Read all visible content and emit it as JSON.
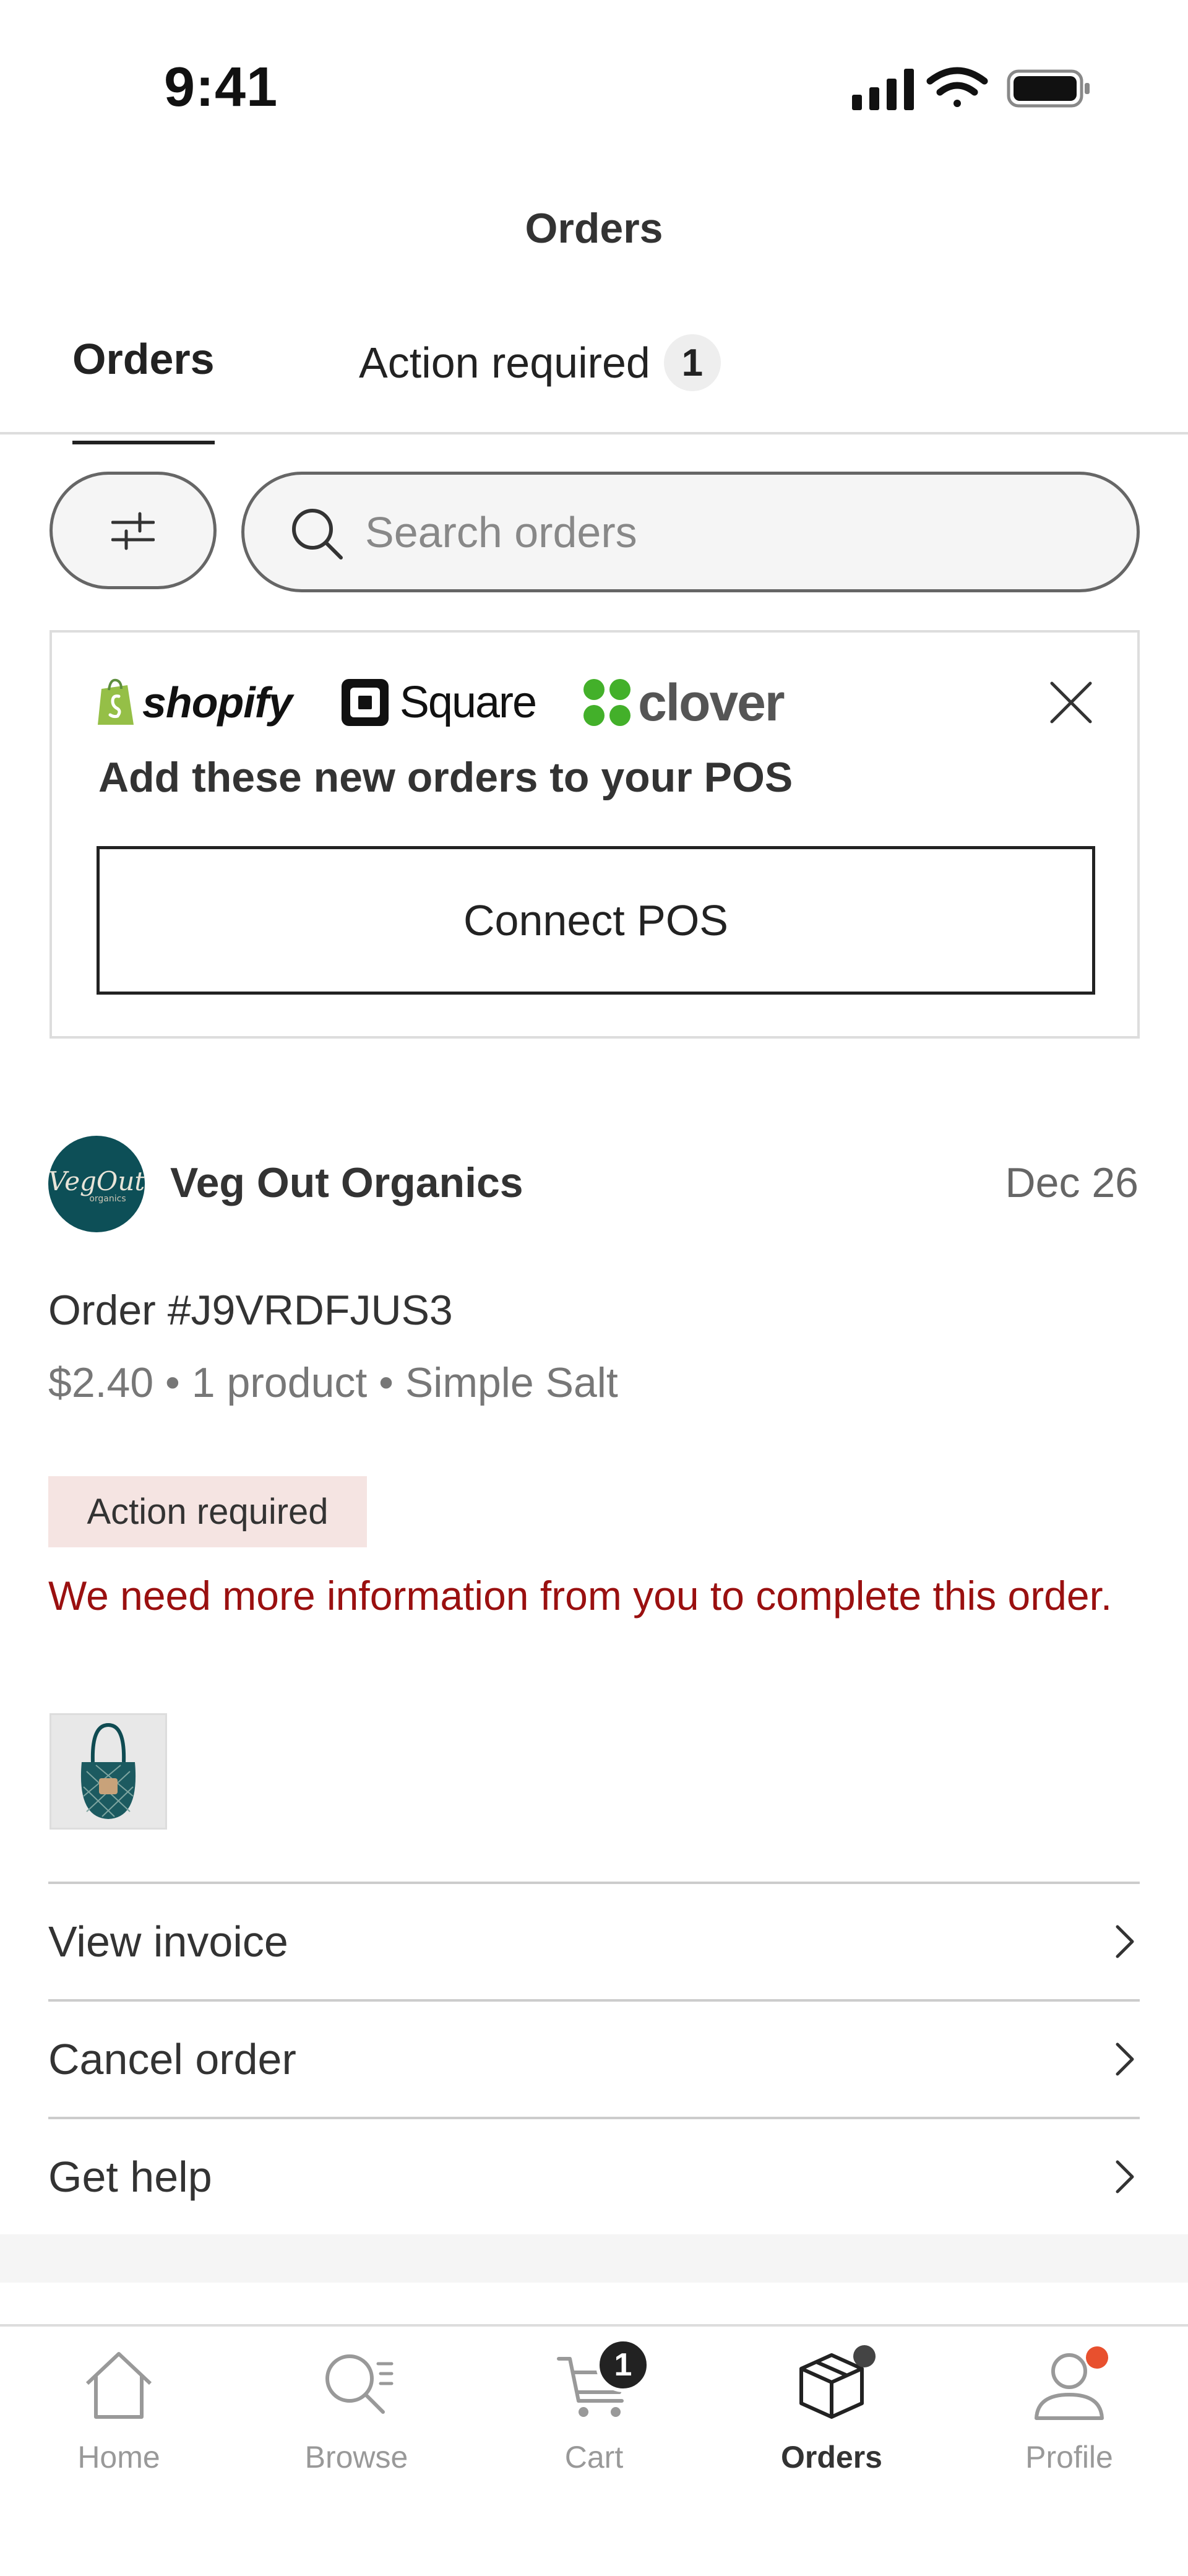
{
  "status_bar": {
    "time": "9:41"
  },
  "header": {
    "title": "Orders"
  },
  "tabs": [
    {
      "label": "Orders",
      "active": true
    },
    {
      "label": "Action required",
      "badge": "1",
      "active": false
    }
  ],
  "search": {
    "placeholder": "Search orders"
  },
  "pos_banner": {
    "logos": {
      "shopify": "shopify",
      "square": "Square",
      "clover": "clover"
    },
    "heading": "Add these new orders to your POS",
    "button_label": "Connect POS"
  },
  "order": {
    "shop_name": "Veg Out Organics",
    "avatar_text": "VegOut",
    "avatar_subtext": "organics",
    "date": "Dec 26",
    "number": "Order #J9VRDFJUS3",
    "summary": "$2.40 • 1 product • Simple Salt",
    "status_badge": "Action required",
    "message": "We need more information from you to complete this order."
  },
  "links": [
    {
      "label": "View invoice"
    },
    {
      "label": "Cancel order"
    },
    {
      "label": "Get help"
    }
  ],
  "bottom_nav": [
    {
      "label": "Home",
      "icon": "home-icon"
    },
    {
      "label": "Browse",
      "icon": "browse-icon"
    },
    {
      "label": "Cart",
      "icon": "cart-icon",
      "badge": "1"
    },
    {
      "label": "Orders",
      "icon": "orders-icon",
      "active": true
    },
    {
      "label": "Profile",
      "icon": "profile-icon"
    }
  ],
  "colors": {
    "alert_text": "#9a1010",
    "alert_badge_bg": "#f5e4e2",
    "avatar_bg": "#0d4f57",
    "shopify_green": "#95bf47",
    "clover_green": "#43b02a",
    "notification_dot": "#e8502e"
  }
}
